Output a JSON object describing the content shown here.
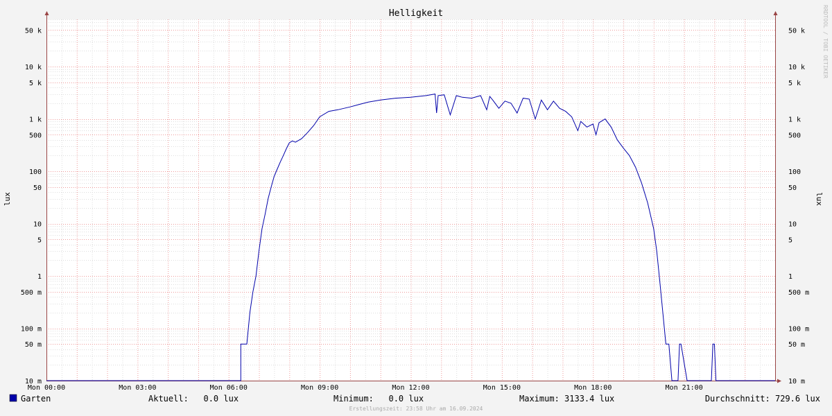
{
  "chart_data": {
    "type": "line",
    "title": "Helligkeit",
    "ylabel": "lux",
    "y_scale": "log",
    "ylim": [
      0.01,
      80000
    ],
    "xlim_hours": [
      0,
      24
    ],
    "x_tick_labels": [
      "Mon 00:00",
      "Mon 03:00",
      "Mon 06:00",
      "Mon 09:00",
      "Mon 12:00",
      "Mon 15:00",
      "Mon 18:00",
      "Mon 21:00"
    ],
    "y_ticks": [
      {
        "value": 50000,
        "label": "50 k"
      },
      {
        "value": 10000,
        "label": "10 k"
      },
      {
        "value": 5000,
        "label": "5 k"
      },
      {
        "value": 1000,
        "label": "1 k"
      },
      {
        "value": 500,
        "label": "500"
      },
      {
        "value": 100,
        "label": "100"
      },
      {
        "value": 50,
        "label": "50"
      },
      {
        "value": 10,
        "label": "10"
      },
      {
        "value": 5,
        "label": "5"
      },
      {
        "value": 1,
        "label": "1"
      },
      {
        "value": 0.5,
        "label": "500 m"
      },
      {
        "value": 0.1,
        "label": "100 m"
      },
      {
        "value": 0.05,
        "label": "50 m"
      },
      {
        "value": 0.01,
        "label": "10 m"
      }
    ],
    "grid": true,
    "colors": {
      "line": "#0000aa",
      "minor_grid": "#dddddd",
      "major_grid": "#ee9999",
      "axis": "#994444",
      "plot_bg": "#ffffff",
      "page_bg": "#f3f3f3"
    },
    "series": [
      {
        "name": "Garten",
        "x": [
          0,
          6.4,
          6.4,
          6.6,
          6.7,
          6.8,
          6.9,
          7.0,
          7.1,
          7.2,
          7.3,
          7.4,
          7.5,
          7.6,
          7.7,
          7.8,
          7.9,
          8.0,
          8.1,
          8.2,
          8.4,
          8.6,
          8.8,
          9.0,
          9.3,
          9.6,
          10.0,
          10.3,
          10.6,
          11.0,
          11.5,
          12.0,
          12.5,
          12.8,
          12.85,
          12.9,
          13.1,
          13.3,
          13.5,
          13.6,
          13.7,
          14.0,
          14.3,
          14.5,
          14.6,
          14.7,
          14.9,
          15.1,
          15.3,
          15.5,
          15.7,
          15.9,
          16.1,
          16.3,
          16.5,
          16.7,
          16.9,
          17.1,
          17.3,
          17.5,
          17.6,
          17.8,
          18.0,
          18.1,
          18.2,
          18.4,
          18.6,
          18.8,
          19.0,
          19.2,
          19.4,
          19.6,
          19.8,
          20.0,
          20.1,
          20.2,
          20.3,
          20.4,
          20.5,
          20.6,
          20.7,
          20.8,
          20.85,
          20.9,
          21.1,
          21.15,
          21.3,
          21.35,
          21.9,
          21.95,
          22.0,
          22.05,
          24.0
        ],
        "y": [
          0.01,
          0.01,
          0.05,
          0.05,
          0.2,
          0.5,
          1,
          3,
          8,
          15,
          30,
          50,
          80,
          110,
          150,
          200,
          270,
          350,
          380,
          360,
          420,
          550,
          750,
          1100,
          1400,
          1500,
          1700,
          1900,
          2100,
          2300,
          2500,
          2600,
          2800,
          3000,
          1300,
          2800,
          2900,
          1200,
          2800,
          2700,
          2600,
          2500,
          2800,
          1500,
          2700,
          2300,
          1600,
          2200,
          2000,
          1300,
          2500,
          2400,
          1000,
          2300,
          1500,
          2200,
          1600,
          1400,
          1100,
          600,
          900,
          700,
          800,
          500,
          850,
          1000,
          700,
          400,
          280,
          200,
          120,
          60,
          25,
          8,
          3,
          0.8,
          0.2,
          0.05,
          0.05,
          0.01,
          0.01,
          0.01,
          0.05,
          0.05,
          0.01,
          0.01,
          0.01,
          0.01,
          0.01,
          0.05,
          0.05,
          0.01,
          0.01
        ]
      }
    ]
  },
  "legend": {
    "series_name": "Garten",
    "swatch_color": "#0000aa",
    "current": "Aktuell:   0.0 lux",
    "minimum": "Minimum:   0.0 lux",
    "maximum": "Maximum: 3133.4 lux",
    "average": "Durchschnitt: 729.6 lux"
  },
  "footer": "Erstellungszeit: 23:58 Uhr am 16.09.2024",
  "watermark": "RRDTOOL / TOBI OETIKER"
}
